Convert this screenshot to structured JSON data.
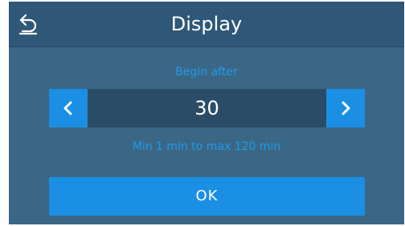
{
  "header": {
    "title": "Display",
    "back_icon": "back-arrow-icon"
  },
  "main": {
    "label": "Begin after",
    "value": "30",
    "range_hint": "Min 1 min to max 120 min",
    "decrement_icon": "chevron-left-icon",
    "increment_icon": "chevron-right-icon",
    "ok_label": "OK"
  },
  "colors": {
    "background": "#3b6787",
    "header": "#2f5878",
    "accent": "#1a8fe3",
    "caption": "#1e9be8",
    "value_field": "#2b4c66"
  }
}
